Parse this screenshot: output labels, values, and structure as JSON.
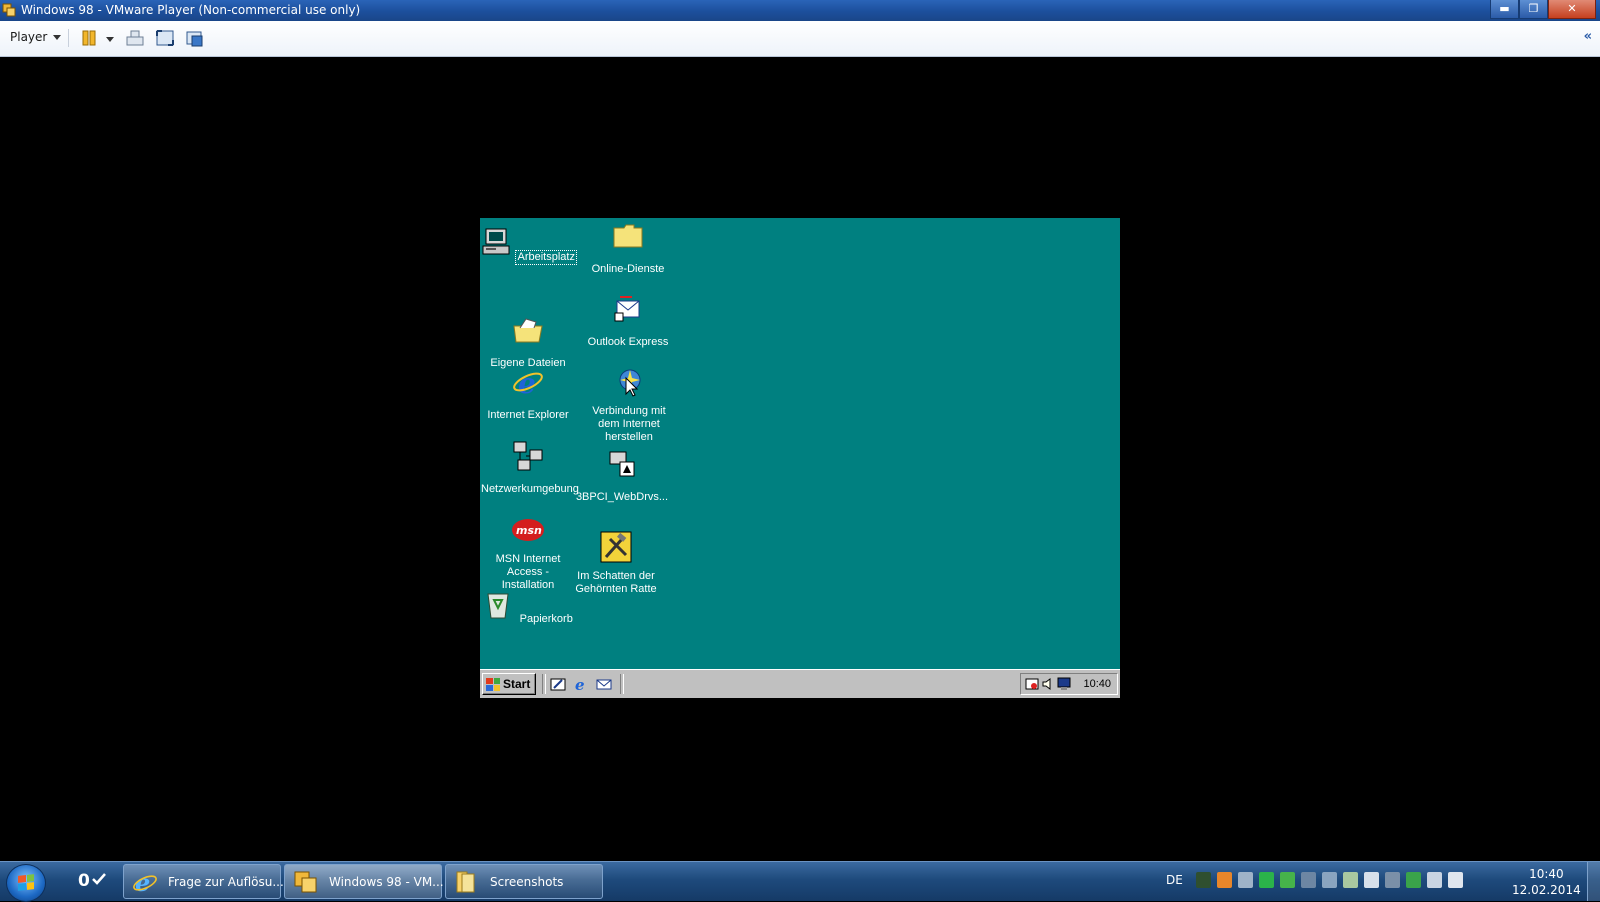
{
  "window": {
    "title": "Windows 98 - VMware Player (Non-commercial use only)",
    "buttons": {
      "minimize": "▬",
      "maximize": "❐",
      "close": "✕"
    }
  },
  "toolbar": {
    "player_label": "Player",
    "icons": [
      "pause-icon",
      "send-ctrl-alt-del-icon",
      "fullscreen-icon",
      "unity-icon"
    ],
    "collapse_label": "«"
  },
  "guest": {
    "background": "#008080",
    "desktop_icons": [
      {
        "label": "Arbeitsplatz",
        "icon": "my-computer-icon"
      },
      {
        "label": "Online-Dienste",
        "icon": "folder-icon"
      },
      {
        "label": "Outlook Express",
        "icon": "outlook-express-icon"
      },
      {
        "label": "Eigene Dateien",
        "icon": "my-documents-icon"
      },
      {
        "label": "Internet Explorer",
        "icon": "internet-explorer-icon"
      },
      {
        "label": "Verbindung mit dem Internet herstellen",
        "icon": "connection-wizard-icon"
      },
      {
        "label": "Netzwerkumgebung",
        "icon": "network-neighborhood-icon"
      },
      {
        "label": "3BPCI_WebDrvs...",
        "icon": "network-drivers-icon"
      },
      {
        "label": "MSN Internet Access - Installation",
        "icon": "msn-icon"
      },
      {
        "label": "Im Schatten der Gehörnten Ratte",
        "icon": "setup-tools-icon"
      },
      {
        "label": "Papierkorb",
        "icon": "recycle-bin-icon"
      }
    ],
    "taskbar": {
      "start_label": "Start",
      "quicklaunch": [
        "show-desktop-icon",
        "internet-explorer-icon",
        "outlook-express-icon"
      ],
      "tray_icons": [
        "scheduler-icon",
        "volume-icon",
        "display-icon"
      ],
      "clock": "10:40"
    }
  },
  "host_taskbar": {
    "outlook_badge": "0",
    "tasks": [
      {
        "label": "Frage zur Auflösu...",
        "icon": "internet-explorer-icon"
      },
      {
        "label": "Windows 98 - VM...",
        "icon": "vmware-icon"
      },
      {
        "label": "Screenshots",
        "icon": "folder-icon"
      }
    ],
    "language": "DE",
    "clock_time": "10:40",
    "clock_date": "12.02.2014"
  },
  "colors": {
    "host_taskbar": "#1e4a7c",
    "guest_desktop": "#008080",
    "win98_gray": "#c0c0c0"
  }
}
